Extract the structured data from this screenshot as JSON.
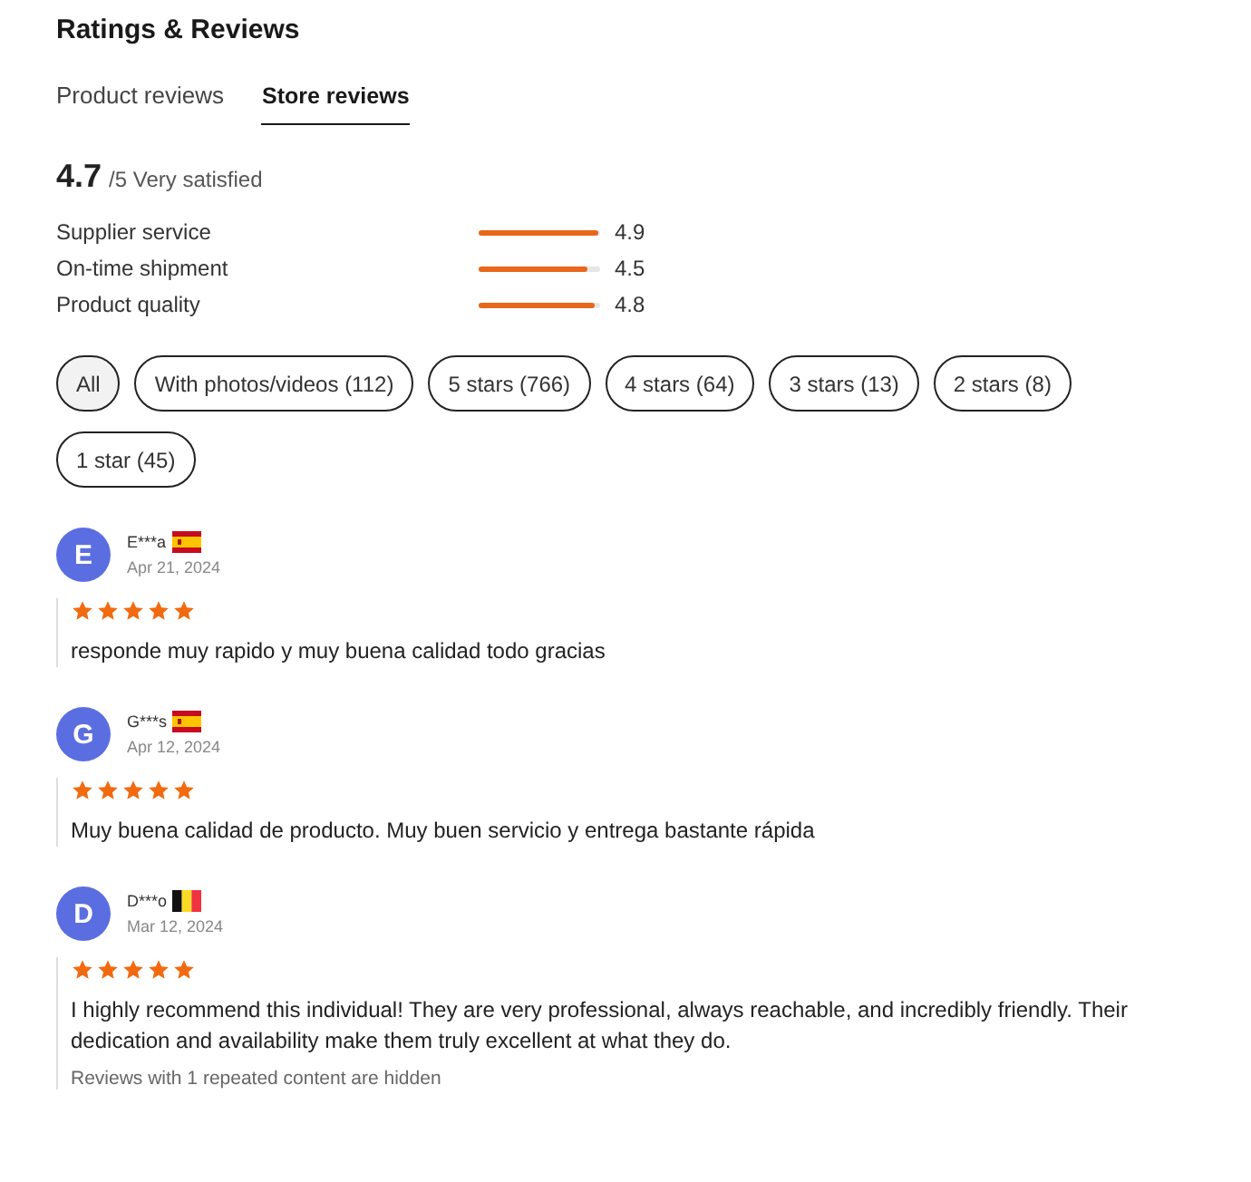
{
  "title": "Ratings & Reviews",
  "tabs": [
    {
      "label": "Product reviews",
      "selected": false
    },
    {
      "label": "Store reviews",
      "selected": true
    }
  ],
  "summary": {
    "score": "4.7",
    "suffix": "/5 Very satisfied"
  },
  "metrics": [
    {
      "name": "Supplier service",
      "level": 0.98,
      "reading": "4.9"
    },
    {
      "name": "On-time shipment",
      "level": 0.9,
      "reading": "4.5"
    },
    {
      "name": "Product quality",
      "level": 0.96,
      "reading": "4.8"
    }
  ],
  "filters": [
    {
      "label": "All",
      "selected": true
    },
    {
      "label": "With photos/videos (112)",
      "selected": false
    },
    {
      "label": "5 stars (766)",
      "selected": false
    },
    {
      "label": "4 stars (64)",
      "selected": false
    },
    {
      "label": "3 stars (13)",
      "selected": false
    },
    {
      "label": "2 stars (8)",
      "selected": false
    },
    {
      "label": "1 star (45)",
      "selected": false
    }
  ],
  "reviews": [
    {
      "initial": "E",
      "name": "E***a",
      "kind": "es",
      "date": "Apr 21, 2024",
      "stars": 5,
      "text": "responde muy rapido y muy buena calidad todo gracias"
    },
    {
      "initial": "G",
      "name": "G***s",
      "kind": "es",
      "date": "Apr 12, 2024",
      "stars": 5,
      "text": "Muy buena calidad de producto. Muy buen servicio y entrega bastante rápida"
    },
    {
      "initial": "D",
      "name": "D***o",
      "kind": "be",
      "date": "Mar 12, 2024",
      "stars": 5,
      "text": "I highly recommend this individual! They are very professional, always reachable, and incredibly friendly. Their dedication and availability make them truly excellent at what they do.",
      "note": "Reviews with 1 repeated content are hidden"
    }
  ]
}
